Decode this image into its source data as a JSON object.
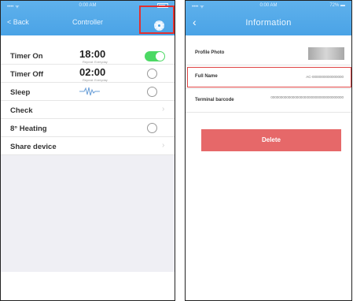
{
  "left_screen": {
    "status": {
      "left": "•••• ᯤ",
      "time": "0:00 AM",
      "right": ""
    },
    "nav": {
      "back_label": "< Back",
      "title": "Controller"
    },
    "rows": [
      {
        "label": "Timer On",
        "value": "18:00",
        "sub": "Repeat: Everyday",
        "control": "toggle-on"
      },
      {
        "label": "Timer Off",
        "value": "02:00",
        "sub": "Repeat: Everyday",
        "control": "toggle-off"
      },
      {
        "label": "Sleep",
        "value": "",
        "sub": "",
        "control": "toggle-off"
      },
      {
        "label": "Check",
        "value": "",
        "sub": "",
        "control": "chevron"
      },
      {
        "label": "8° Heating",
        "value": "",
        "sub": "",
        "control": "toggle-off"
      },
      {
        "label": "Share device",
        "value": "",
        "sub": "",
        "control": "chevron"
      }
    ]
  },
  "right_screen": {
    "status": {
      "left": "•••• ᯤ",
      "time": "0:00 AM",
      "right": "72% ▬"
    },
    "nav": {
      "back_icon": "‹",
      "title": "Information"
    },
    "rows": {
      "profile_label": "Profile Photo",
      "name_label": "Full Name",
      "name_value": "AC-0000000000000000",
      "barcode_label": "Terminal barcode",
      "barcode_value": "0000000000000000000000000000000000000"
    },
    "delete_label": "Delete"
  }
}
